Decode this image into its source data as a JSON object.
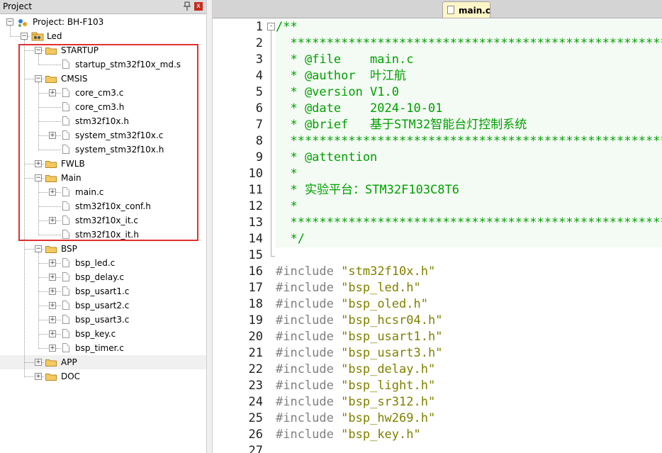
{
  "project_pane": {
    "title": "Project",
    "pin_label": "p",
    "close_label": "x",
    "rows": [
      {
        "label": "Project: BH-F103",
        "level": 0,
        "kind": "project",
        "toggle": "-"
      },
      {
        "label": "Led",
        "level": 1,
        "kind": "group",
        "toggle": "-"
      },
      {
        "label": "STARTUP",
        "level": 2,
        "kind": "folder",
        "toggle": "-"
      },
      {
        "label": "startup_stm32f10x_md.s",
        "level": 3,
        "kind": "file",
        "toggle": ""
      },
      {
        "label": "CMSIS",
        "level": 2,
        "kind": "folder",
        "toggle": "-"
      },
      {
        "label": "core_cm3.c",
        "level": 3,
        "kind": "file",
        "toggle": "+"
      },
      {
        "label": "core_cm3.h",
        "level": 3,
        "kind": "file",
        "toggle": ""
      },
      {
        "label": "stm32f10x.h",
        "level": 3,
        "kind": "file",
        "toggle": ""
      },
      {
        "label": "system_stm32f10x.c",
        "level": 3,
        "kind": "file",
        "toggle": "+"
      },
      {
        "label": "system_stm32f10x.h",
        "level": 3,
        "kind": "file",
        "toggle": ""
      },
      {
        "label": "FWLB",
        "level": 2,
        "kind": "folder",
        "toggle": "+"
      },
      {
        "label": "Main",
        "level": 2,
        "kind": "folder",
        "toggle": "-"
      },
      {
        "label": "main.c",
        "level": 3,
        "kind": "file",
        "toggle": "+"
      },
      {
        "label": "stm32f10x_conf.h",
        "level": 3,
        "kind": "file",
        "toggle": ""
      },
      {
        "label": "stm32f10x_it.c",
        "level": 3,
        "kind": "file",
        "toggle": "+"
      },
      {
        "label": "stm32f10x_it.h",
        "level": 3,
        "kind": "file",
        "toggle": ""
      },
      {
        "label": "BSP",
        "level": 2,
        "kind": "folder",
        "toggle": "-"
      },
      {
        "label": "bsp_led.c",
        "level": 3,
        "kind": "file",
        "toggle": "+"
      },
      {
        "label": "bsp_delay.c",
        "level": 3,
        "kind": "file",
        "toggle": "+"
      },
      {
        "label": "bsp_usart1.c",
        "level": 3,
        "kind": "file",
        "toggle": "+"
      },
      {
        "label": "bsp_usart2.c",
        "level": 3,
        "kind": "file",
        "toggle": "+"
      },
      {
        "label": "bsp_usart3.c",
        "level": 3,
        "kind": "file",
        "toggle": "+"
      },
      {
        "label": "bsp_key.c",
        "level": 3,
        "kind": "file",
        "toggle": "+"
      },
      {
        "label": "bsp_timer.c",
        "level": 3,
        "kind": "file",
        "toggle": "+"
      },
      {
        "label": "APP",
        "level": 2,
        "kind": "folder",
        "toggle": "+"
      },
      {
        "label": "DOC",
        "level": 2,
        "kind": "folder",
        "toggle": "+"
      }
    ]
  },
  "editor": {
    "tab_label": "main.c",
    "fold_toggle": "-",
    "lines": [
      {
        "n": "1",
        "type": "comment",
        "text": "/**"
      },
      {
        "n": "2",
        "type": "comment",
        "text": "  ******************************************************************"
      },
      {
        "n": "3",
        "type": "comment",
        "text": "  * @file    main.c"
      },
      {
        "n": "4",
        "type": "comment",
        "text": "  * @author  叶江航"
      },
      {
        "n": "5",
        "type": "comment",
        "text": "  * @version V1.0"
      },
      {
        "n": "6",
        "type": "comment",
        "text": "  * @date    2024-10-01"
      },
      {
        "n": "7",
        "type": "comment",
        "text": "  * @brief   基于STM32智能台灯控制系统"
      },
      {
        "n": "8",
        "type": "comment",
        "text": "  ******************************************************************"
      },
      {
        "n": "9",
        "type": "comment",
        "text": "  * @attention"
      },
      {
        "n": "10",
        "type": "comment",
        "text": "  *"
      },
      {
        "n": "11",
        "type": "comment",
        "text": "  * 实验平台：STM32F103C8T6"
      },
      {
        "n": "12",
        "type": "comment",
        "text": "  *"
      },
      {
        "n": "13",
        "type": "comment",
        "text": "  ******************************************************************"
      },
      {
        "n": "14",
        "type": "comment",
        "text": "  */"
      },
      {
        "n": "15",
        "type": "blank",
        "text": ""
      },
      {
        "n": "16",
        "type": "include",
        "directive": "#include",
        "file": "\"stm32f10x.h\""
      },
      {
        "n": "17",
        "type": "include",
        "directive": "#include",
        "file": "\"bsp_led.h\""
      },
      {
        "n": "18",
        "type": "include",
        "directive": "#include",
        "file": "\"bsp_oled.h\""
      },
      {
        "n": "19",
        "type": "include",
        "directive": "#include",
        "file": "\"bsp_hcsr04.h\""
      },
      {
        "n": "20",
        "type": "include",
        "directive": "#include",
        "file": "\"bsp_usart1.h\""
      },
      {
        "n": "21",
        "type": "include",
        "directive": "#include",
        "file": "\"bsp_usart3.h\""
      },
      {
        "n": "22",
        "type": "include",
        "directive": "#include",
        "file": "\"bsp_delay.h\""
      },
      {
        "n": "23",
        "type": "include",
        "directive": "#include",
        "file": "\"bsp_light.h\""
      },
      {
        "n": "24",
        "type": "include",
        "directive": "#include",
        "file": "\"bsp_sr312.h\""
      },
      {
        "n": "25",
        "type": "include",
        "directive": "#include",
        "file": "\"bsp_hw269.h\""
      },
      {
        "n": "26",
        "type": "include",
        "directive": "#include",
        "file": "\"bsp_key.h\""
      },
      {
        "n": "27",
        "type": "blank",
        "text": ""
      }
    ]
  },
  "colors": {
    "comment": "#00a000",
    "directive": "#808080",
    "string": "#808000",
    "highlight_box": "#e03030",
    "tab_bg": "#fff6c7"
  }
}
